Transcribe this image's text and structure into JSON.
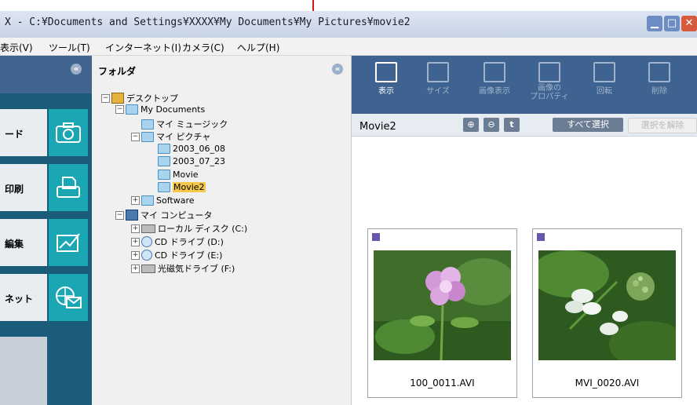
{
  "window": {
    "title": "X - C:¥Documents and Settings¥XXXX¥My Documents¥My Pictures¥movie2",
    "controls": [
      "minimize",
      "maximize",
      "close"
    ]
  },
  "menu": {
    "items": [
      "表示(V)",
      "ツール(T)",
      "インターネット(I)",
      "カメラ(C)",
      "ヘルプ(H)"
    ]
  },
  "left_nav": {
    "items": [
      {
        "label": "ード",
        "icon": "camera-icon"
      },
      {
        "label": "印刷",
        "icon": "print-icon"
      },
      {
        "label": "編集",
        "icon": "edit-icon"
      },
      {
        "label": "ネット",
        "icon": "internet-mail-icon"
      }
    ]
  },
  "folder_panel": {
    "title": "フォルダ",
    "tree": [
      {
        "label": "デスクトップ",
        "icon": "desktop-icon",
        "expander": "-"
      },
      {
        "label": "My Documents",
        "icon": "folder-open-icon",
        "expander": "-"
      },
      {
        "label": "マイ ミュージック",
        "icon": "folder-icon",
        "expander": ""
      },
      {
        "label": "マイ ピクチャ",
        "icon": "folder-open-icon",
        "expander": "-"
      },
      {
        "label": "2003_06_08",
        "icon": "folder-icon",
        "expander": ""
      },
      {
        "label": "2003_07_23",
        "icon": "folder-icon",
        "expander": ""
      },
      {
        "label": "Movie",
        "icon": "folder-icon",
        "expander": ""
      },
      {
        "label": "Movie2",
        "icon": "folder-open-icon",
        "expander": "",
        "selected": true
      },
      {
        "label": "Software",
        "icon": "folder-icon",
        "expander": "+"
      },
      {
        "label": "マイ コンピュータ",
        "icon": "computer-icon",
        "expander": "-"
      },
      {
        "label": "ローカル ディスク (C:)",
        "icon": "hard-disk-icon",
        "expander": "+"
      },
      {
        "label": "CD ドライブ (D:)",
        "icon": "cd-drive-icon",
        "expander": "+"
      },
      {
        "label": "CD ドライブ (E:)",
        "icon": "cd-drive-icon",
        "expander": "+"
      },
      {
        "label": "光磁気ドライブ (F:)",
        "icon": "mo-drive-icon",
        "expander": "+"
      }
    ]
  },
  "toolbar": {
    "buttons": [
      {
        "label": "表示",
        "icon": "view-icon"
      },
      {
        "label": "サイズ",
        "icon": "size-icon"
      },
      {
        "label": "画像表示",
        "icon": "image-view-icon"
      },
      {
        "label": "画像の\nプロパティ",
        "icon": "image-properties-icon"
      },
      {
        "label": "回転",
        "icon": "rotate-icon"
      },
      {
        "label": "削除",
        "icon": "delete-icon"
      }
    ]
  },
  "path_bar": {
    "current_folder": "Movie2",
    "zoom_in": "⊕",
    "zoom_out": "⊖",
    "up": "t",
    "select_all": "すべて選択",
    "deselect": "選択を解除"
  },
  "thumbnails": [
    {
      "file": "100_0011.AVI",
      "type_icon": "movie-icon"
    },
    {
      "file": "MVI_0020.AVI",
      "type_icon": "movie-icon"
    }
  ],
  "colors": {
    "toolbar_bg": "#3f6390",
    "nav_accent": "#1ba6b4",
    "selection": "#f6c84a",
    "leader_line": "#d01818"
  }
}
